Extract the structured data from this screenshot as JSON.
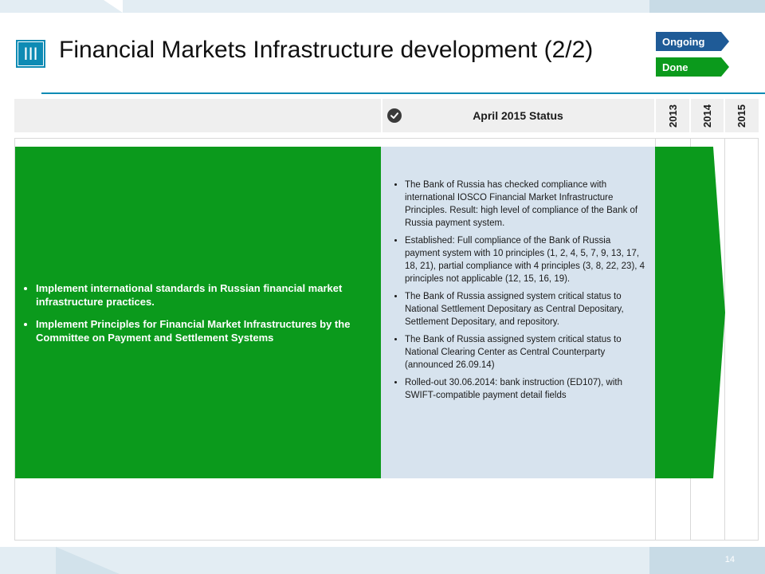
{
  "slide": {
    "section_numeral": "III",
    "title": "Financial Markets Infrastructure development (2/2)",
    "page_number": "14"
  },
  "legend": {
    "ongoing": {
      "label": "Ongoing",
      "color": "#1f5b97"
    },
    "done": {
      "label": "Done",
      "color": "#0b9a1c"
    }
  },
  "table": {
    "status_header": "April 2015 Status",
    "years": [
      "2013",
      "2014",
      "2015"
    ],
    "goals": [
      "Implement international standards in Russian financial market infrastructure practices.",
      "Implement Principles for Financial Market Infrastructures by the Committee on Payment and Settlement Systems"
    ],
    "status_items": [
      "The Bank of Russia has checked compliance with international IOSCO Financial Market Infrastructure Principles. Result: high level of compliance of the Bank of Russia payment system.",
      "Established: Full compliance of the Bank of Russia payment system with 10 principles (1, 2, 4, 5, 7, 9, 13, 17, 18, 21), partial compliance with 4 principles (3, 8, 22, 23), 4 principles not applicable (12, 15, 16, 19).",
      "The Bank of Russia assigned system critical status to National Settlement Depositary as Central Depositary, Settlement Depositary, and repository.",
      "The Bank of Russia assigned system critical status to National Clearing Center as Central Counterparty (announced 26.09.14)",
      "Rolled-out 30.06.2014: bank instruction (ED107), with SWIFT-compatible payment detail fields"
    ],
    "timeline_status": "done",
    "done_color": "#0b9a1c",
    "status_bg_color": "#d7e3ee"
  }
}
